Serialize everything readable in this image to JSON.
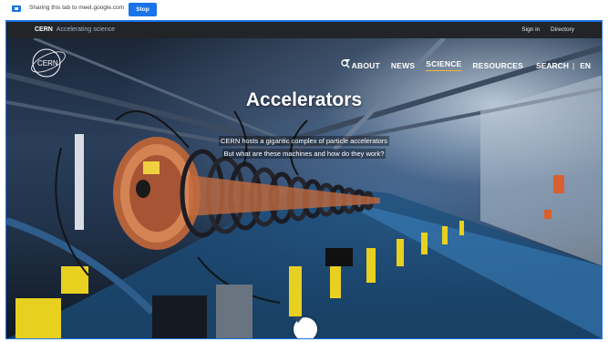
{
  "share_bar": {
    "message": "Sharing this tab to meet.google.com",
    "stop_label": "Stop"
  },
  "cern_strip": {
    "brand": "CERN",
    "tagline": "Accelerating science",
    "links": [
      "Sign in",
      "Directory"
    ]
  },
  "nav": {
    "items": [
      "ABOUT",
      "NEWS",
      "SCIENCE",
      "RESOURCES"
    ],
    "active": "SCIENCE",
    "search_label": "SEARCH",
    "separator": "|",
    "language": "EN"
  },
  "hero": {
    "title": "Accelerators",
    "line1": "CERN hosts a gigantic complex of particle accelerators",
    "line2": "But what are these machines and how do they work?"
  },
  "colors": {
    "share_blue": "#1a73e8",
    "strip_bg": "#222427",
    "active_underline": "#f0b43c"
  },
  "icons": {
    "share": "screen-share-icon",
    "logo": "cern-logo",
    "search": "search-icon",
    "lang_caret": "chevron-down-icon",
    "scroll": "chevron-down-icon"
  }
}
